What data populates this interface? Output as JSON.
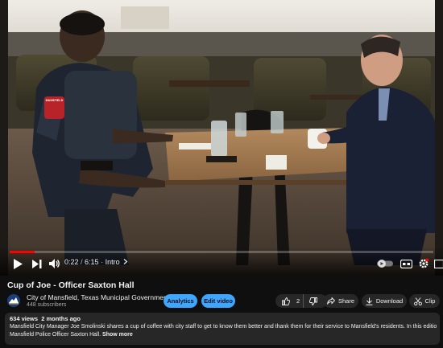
{
  "player": {
    "time_current": "0:22",
    "time_total": "6:15",
    "chapter": "Intro",
    "progress_fraction": 0.059,
    "accent_color": "#ff0000",
    "badge_text": "MANSFIELD",
    "icons": [
      "play-icon",
      "next-icon",
      "volume-icon",
      "chevron-right-icon",
      "autoplay-toggle-icon",
      "subtitles-icon",
      "settings-icon",
      "miniplayer-icon"
    ]
  },
  "video": {
    "title": "Cup of Joe - Officer Saxton Hall",
    "channel_name": "City of Mansfield, Texas Municipal Government",
    "subscribers": "448 subscribers"
  },
  "actions": {
    "analytics": "Analytics",
    "edit_video": "Edit video",
    "like_count": "2",
    "share": "Share",
    "download": "Download",
    "clip": "Clip"
  },
  "description": {
    "views": "634 views",
    "age": "2 months ago",
    "text_line1": "Mansfield City Manager Joe Smolinski shares a cup of coffee with city staff to get to know them better and thank them for their service to Mansfield's residents. In this edition, he sits down with",
    "text_line2": "Mansfield Police Officer Saxton Hall.",
    "show_more": "Show more"
  }
}
